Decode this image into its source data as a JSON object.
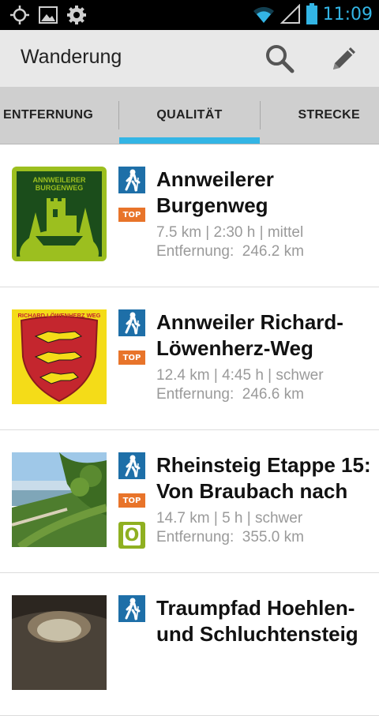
{
  "statusbar": {
    "time": "11:09",
    "icons": [
      "gps-icon",
      "picture-icon",
      "settings-icon",
      "wifi-icon",
      "signal-icon",
      "battery-icon"
    ]
  },
  "actionbar": {
    "title": "Wanderung",
    "search_icon": "search-icon",
    "edit_icon": "pencil-icon"
  },
  "tabs": [
    {
      "label": "ENTFERNUNG",
      "selected": false
    },
    {
      "label": "QUALITÄT",
      "selected": true
    },
    {
      "label": "STRECKE",
      "selected": false
    }
  ],
  "colors": {
    "accent": "#33b5e5",
    "hike_icon_bg": "#1e6fa8",
    "top_badge": "#e8742a",
    "o_badge": "#8fb021"
  },
  "items": [
    {
      "title_line1": "Annweilerer",
      "title_line2": "Burgenweg",
      "meta": "7.5 km | 2:30 h | mittel",
      "distance": "Entfernung:  246.2 km",
      "top_label": "TOP",
      "logo_text_line1": "ANNWEILERER",
      "logo_text_line2": "BURGENWEG"
    },
    {
      "title_line1": "Annweiler Richard-",
      "title_line2": "Löwenherz-Weg",
      "meta": "12.4 km | 4:45 h | schwer",
      "distance": "Entfernung:  246.6 km",
      "top_label": "TOP",
      "logo_text": "RICHARD LÖWENHERZ WEG"
    },
    {
      "title_line1": "Rheinsteig Etappe 15:",
      "title_line2": "Von Braubach nach",
      "meta": "14.7 km | 5 h | schwer",
      "distance": "Entfernung:  355.0 km",
      "top_label": "TOP",
      "o_label": "O"
    },
    {
      "title_line1": "Traumpfad Hoehlen-",
      "title_line2": "und Schluchtensteig"
    }
  ]
}
